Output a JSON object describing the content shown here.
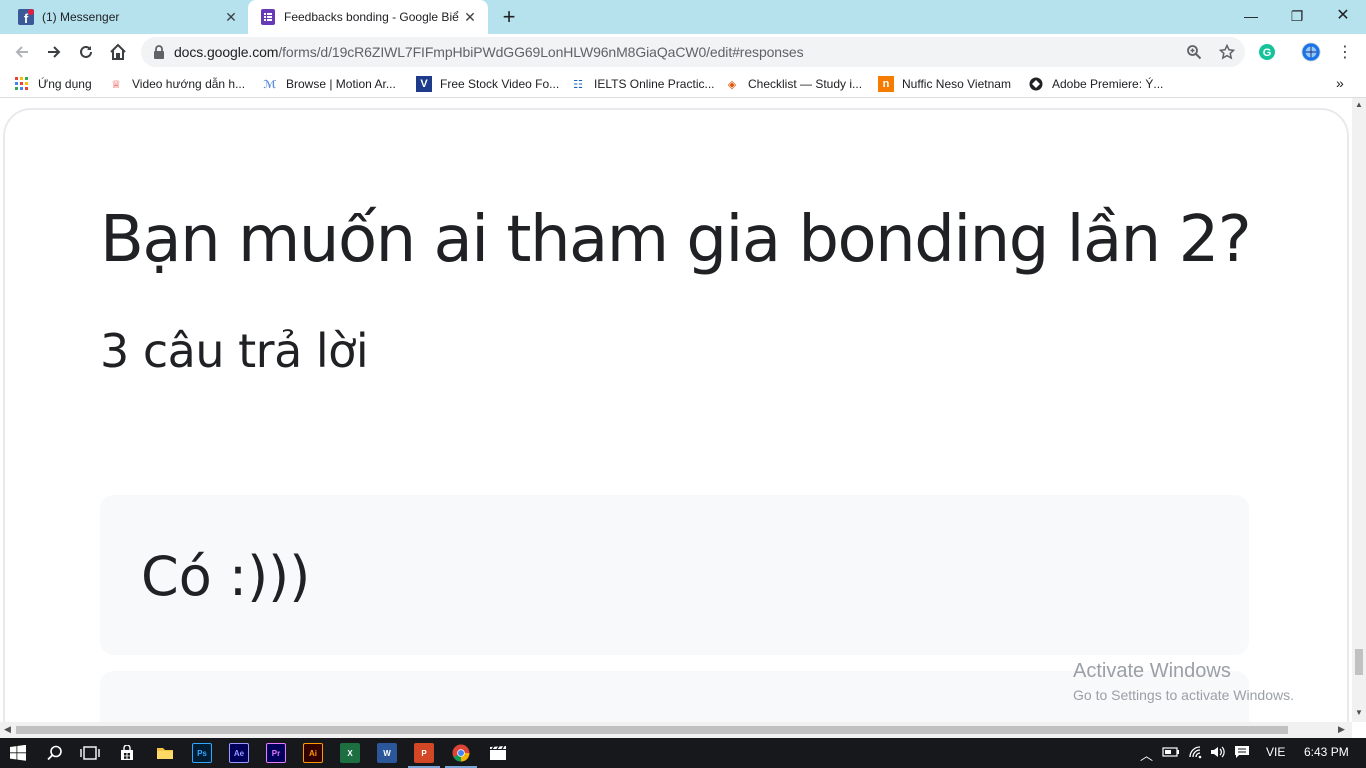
{
  "browser": {
    "tabs": [
      {
        "title": "(1) Messenger",
        "icon": "facebook-icon",
        "active": false
      },
      {
        "title": "Feedbacks bonding - Google Biể",
        "icon": "google-forms-icon",
        "active": true
      }
    ],
    "url_main": "docs.google.com",
    "url_path": "/forms/d/19cR6ZIWL7FIFmpHbiPWdGG69LonHLW96nM8GiaQaCW0/edit#responses"
  },
  "bookmarks": [
    {
      "label": "Ứng dụng",
      "icon": "apps-grid-icon"
    },
    {
      "label": "Video hướng dẫn h...",
      "icon": "video-icon"
    },
    {
      "label": "Browse | Motion Ar...",
      "icon": "motion-array-icon"
    },
    {
      "label": "Free Stock Video Fo...",
      "icon": "videvo-icon"
    },
    {
      "label": "IELTS Online Practic...",
      "icon": "ielts-icon"
    },
    {
      "label": "Checklist — Study i...",
      "icon": "checklist-icon"
    },
    {
      "label": "Nuffic Neso Vietnam",
      "icon": "nuffic-icon"
    },
    {
      "label": "Adobe Premiere: Ý...",
      "icon": "adobe-icon"
    }
  ],
  "form": {
    "question": "Bạn muốn ai tham gia bonding lần 2?",
    "response_count": "3 câu trả lời",
    "responses": [
      "Có :)))",
      ""
    ]
  },
  "watermark": {
    "line1": "Activate Windows",
    "line2": "Go to Settings to activate Windows."
  },
  "taskbar": {
    "language": "VIE",
    "time": "6:43 PM"
  },
  "colors": {
    "tabstrip": "#b6e2ee",
    "card_border": "#e8eaed",
    "response_bg": "#f8f9fa",
    "taskbar": "#17181c"
  }
}
